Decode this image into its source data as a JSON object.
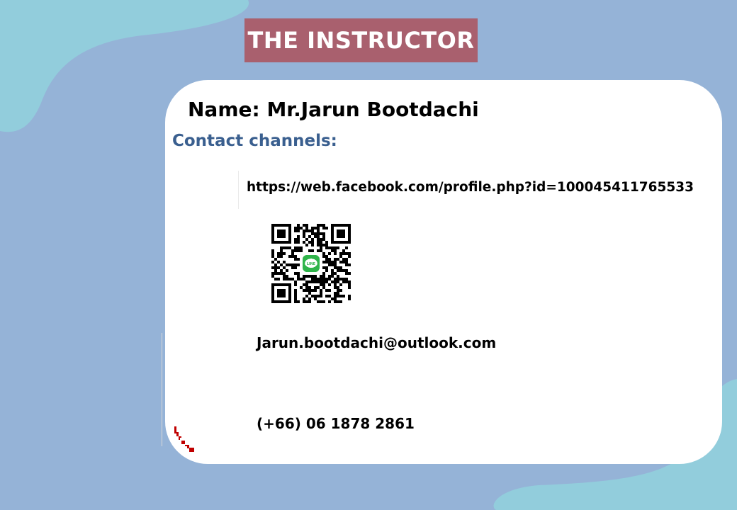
{
  "colors": {
    "background": "#95b3d7",
    "blob": "#92cddc",
    "title_box": "#a9606e",
    "card": "#ffffff",
    "heading_blue": "#3a5f8f",
    "line_green": "#2fb44a"
  },
  "header": {
    "title": "THE INSTRUCTOR"
  },
  "instructor": {
    "name": "Name: Mr.Jarun Bootdachi"
  },
  "contact": {
    "heading": "Contact channels:",
    "facebook_url": "https://web.facebook.com/profile.php?id=100045411765533",
    "qr_icon": "line-qr-code",
    "qr_center_label": "LINE",
    "email": "Jarun.bootdachi@outlook.com",
    "phone": "(+66) 06 1878 2861"
  }
}
